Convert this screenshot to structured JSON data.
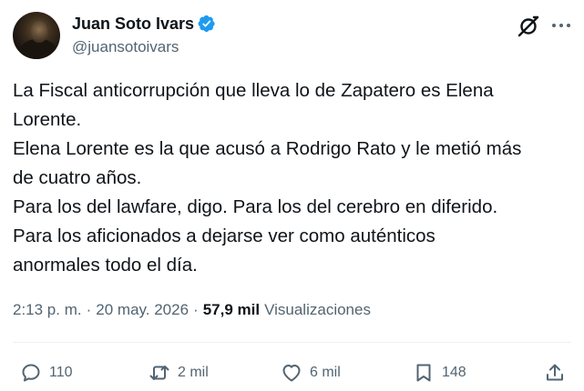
{
  "author": {
    "name": "Juan Soto Ivars",
    "handle": "@juansotoivars",
    "verified": true,
    "accent": "#1d9bf0"
  },
  "tweet": {
    "lines": [
      "La Fiscal anticorrupción que lleva lo de Zapatero es Elena",
      "Lorente.",
      "Elena Lorente es la que acusó a Rodrigo Rato y le metió más",
      "de cuatro años.",
      "Para los del lawfare, digo. Para los del cerebro en diferido.",
      "Para los aficionados a dejarse ver como auténticos",
      "anormales todo el día."
    ]
  },
  "meta": {
    "time": "2:13 p. m.",
    "separator1": "·",
    "date": "20 may. 2026",
    "separator2": "·",
    "views_count": "57,9 mil",
    "views_label": "Visualizaciones"
  },
  "actions": {
    "replies": "110",
    "reposts": "2 mil",
    "likes": "6 mil",
    "bookmarks": "148"
  },
  "icons": [
    "verified-badge-icon",
    "grok-icon",
    "more-icon",
    "reply-icon",
    "repost-icon",
    "like-icon",
    "bookmark-icon",
    "share-icon"
  ]
}
